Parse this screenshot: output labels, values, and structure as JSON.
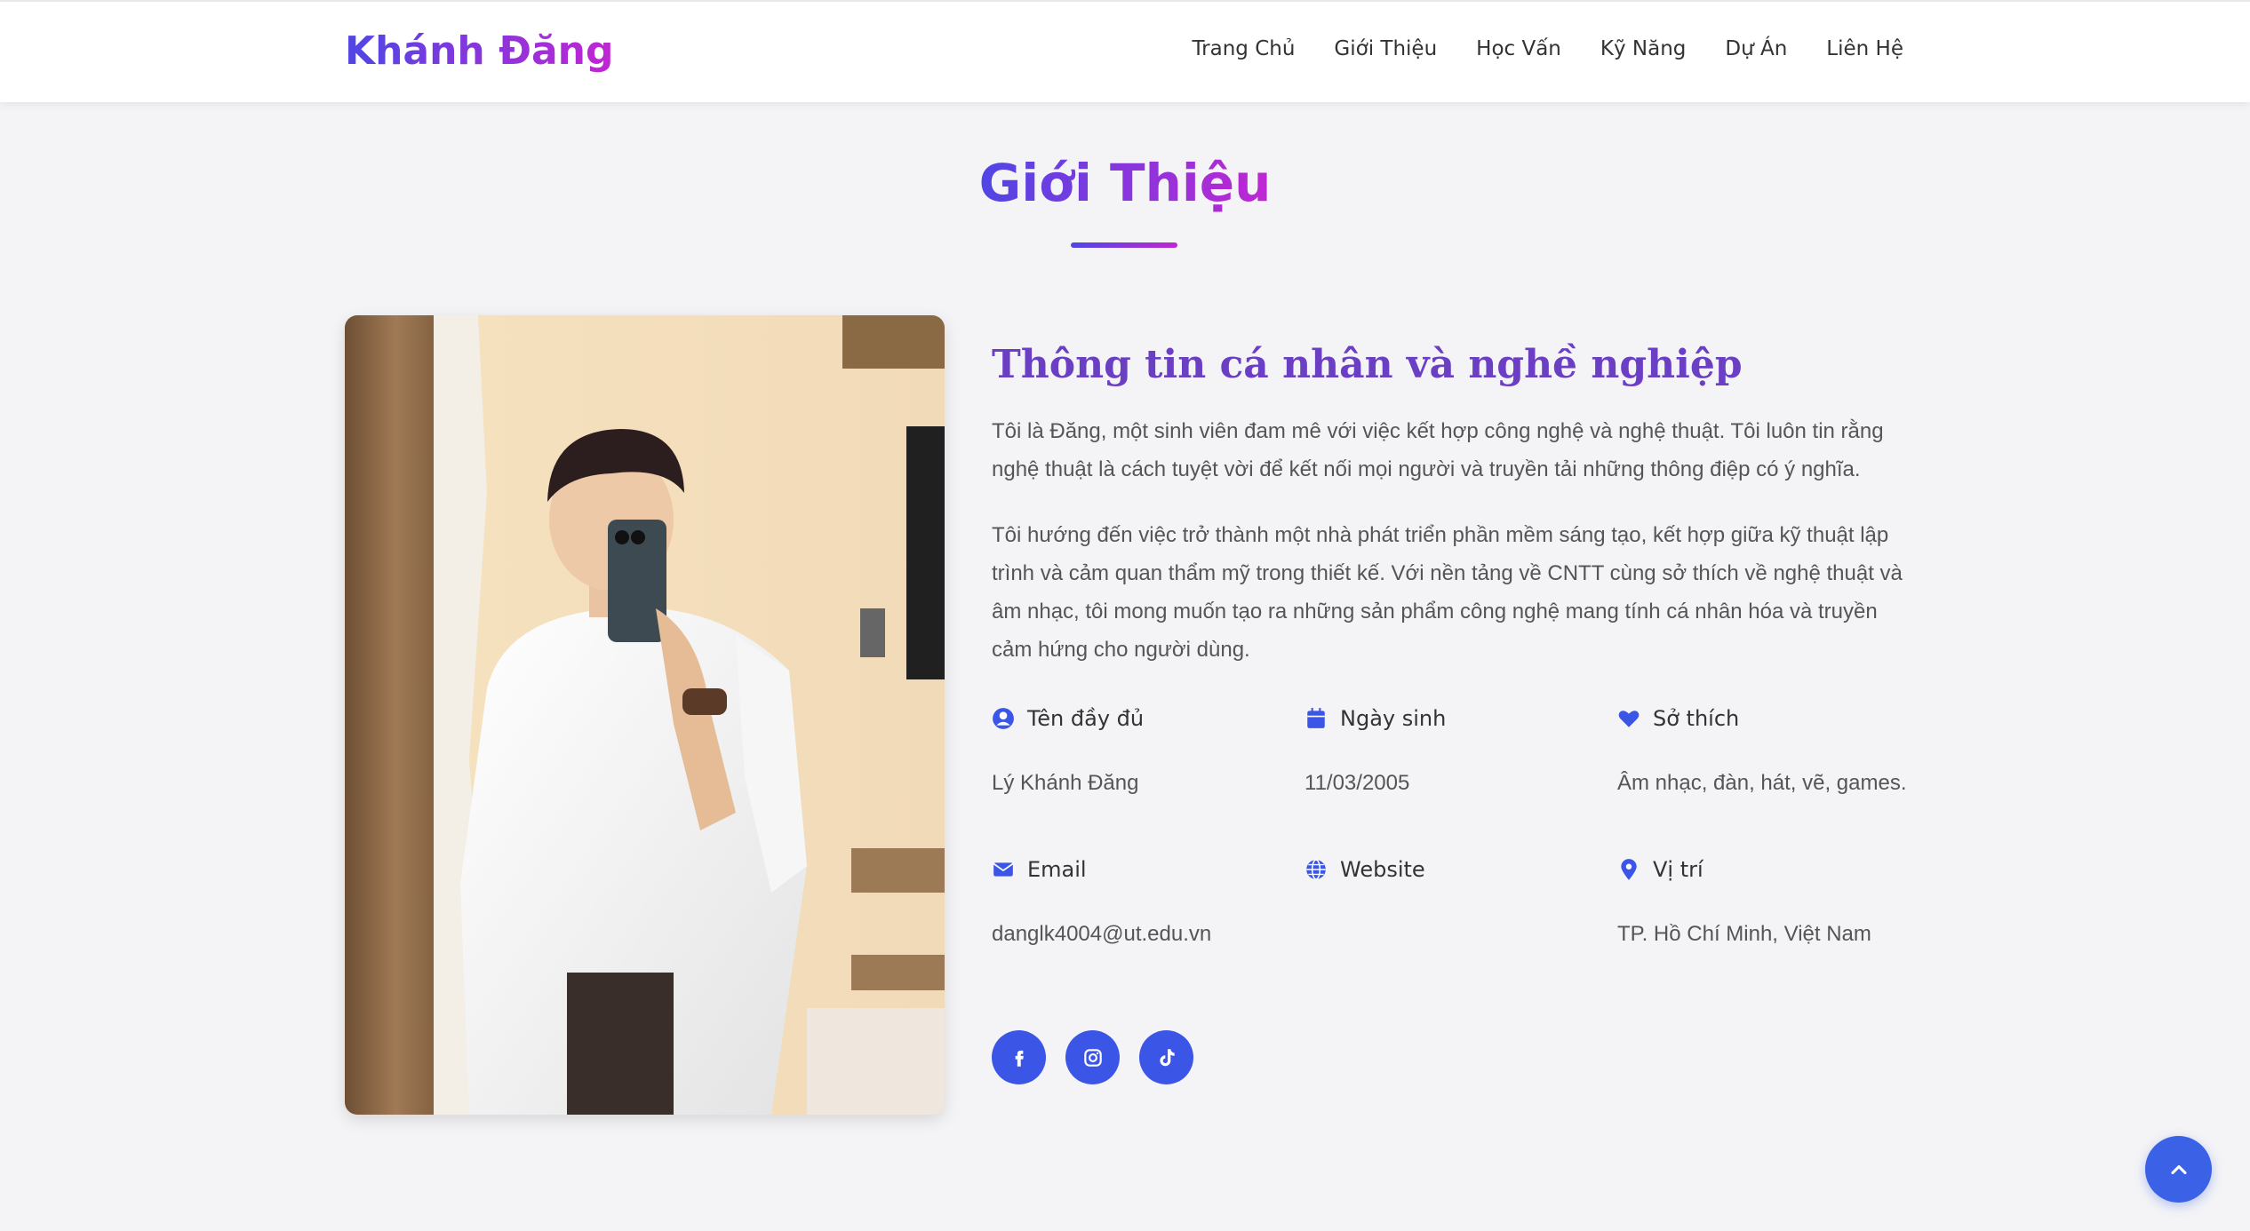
{
  "header": {
    "logo": "Khánh Đăng",
    "nav": [
      "Trang Chủ",
      "Giới Thiệu",
      "Học Vấn",
      "Kỹ Năng",
      "Dự Án",
      "Liên Hệ"
    ]
  },
  "about": {
    "title": "Giới Thiệu",
    "subtitle": "Thông tin cá nhân và nghề nghiệp",
    "paragraph1": "Tôi là Đăng, một sinh viên đam mê với việc kết hợp công nghệ và nghệ thuật. Tôi luôn tin rằng nghệ thuật là cách tuyệt vời để kết nối mọi người và truyền tải những thông điệp có ý nghĩa.",
    "paragraph2": "Tôi hướng đến việc trở thành một nhà phát triển phần mềm sáng tạo, kết hợp giữa kỹ thuật lập trình và cảm quan thẩm mỹ trong thiết kế. Với nền tảng về CNTT cùng sở thích về nghệ thuật và âm nhạc, tôi mong muốn tạo ra những sản phẩm công nghệ mang tính cá nhân hóa và truyền cảm hứng cho người dùng.",
    "info": [
      {
        "icon": "user-circle-icon",
        "label": "Tên đầy đủ",
        "value": "Lý Khánh Đăng"
      },
      {
        "icon": "calendar-icon",
        "label": "Ngày sinh",
        "value": "11/03/2005"
      },
      {
        "icon": "heart-icon",
        "label": "Sở thích",
        "value": "Âm nhạc, đàn, hát, vẽ, games."
      },
      {
        "icon": "envelope-icon",
        "label": "Email",
        "value": "danglk4004@ut.edu.vn"
      },
      {
        "icon": "globe-icon",
        "label": "Website",
        "value": ""
      },
      {
        "icon": "map-pin-icon",
        "label": "Vị trí",
        "value": "TP. Hồ Chí Minh, Việt Nam"
      }
    ],
    "social": [
      "facebook-icon",
      "instagram-icon",
      "tiktok-icon"
    ]
  },
  "colors": {
    "accent": "#3b55e6",
    "gradient_start": "#4f46e5",
    "gradient_end": "#c026d3",
    "subtitle": "#6b3fc4",
    "background": "#f4f4f6"
  }
}
